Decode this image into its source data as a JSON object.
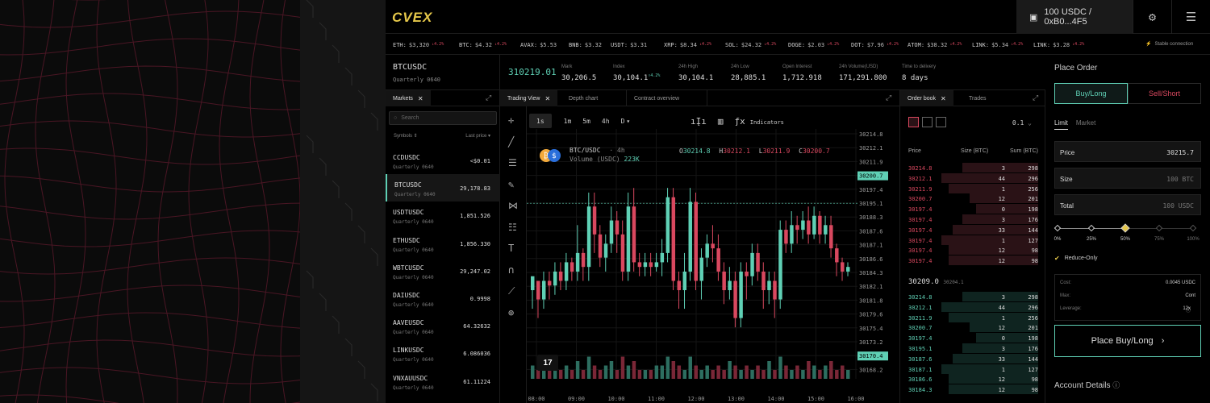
{
  "app": {
    "logo": "CVEX",
    "wallet": "100 USDC / 0xB0...4F5"
  },
  "ticker": [
    {
      "name": "ETH:",
      "price": "$3,320",
      "change": "↓4.2%"
    },
    {
      "name": "BTC:",
      "price": "$4.32",
      "change": "↓4.2%"
    },
    {
      "name": "AVAX:",
      "price": "$5.53",
      "change": ""
    },
    {
      "name": "BNB:",
      "price": "$3.32",
      "change": ""
    },
    {
      "name": "USDT:",
      "price": "$3.31",
      "change": ""
    },
    {
      "name": "XRP:",
      "price": "$8.34",
      "change": "↓4.2%"
    },
    {
      "name": "SOL:",
      "price": "$24.32",
      "change": "↓4.2%"
    },
    {
      "name": "DOGE:",
      "price": "$2.03",
      "change": "↓4.2%"
    },
    {
      "name": "DOT:",
      "price": "$7.96",
      "change": "↓4.2%"
    },
    {
      "name": "ATOM:",
      "price": "$38.32",
      "change": "↓4.2%"
    },
    {
      "name": "LINK:",
      "price": "$5.34",
      "change": "↓4.2%"
    },
    {
      "name": "LINK:",
      "price": "$3.28",
      "change": "↓4.2%"
    }
  ],
  "connection": "Stable connection",
  "symbol": {
    "name": "BTCUSDC",
    "sub": "Quarterly 0640"
  },
  "last_price": "310219.01",
  "stats": [
    {
      "label": "Mark",
      "value": "30,206.5",
      "sup": ""
    },
    {
      "label": "Index",
      "value": "30,104.1",
      "sup": "↑4.2%"
    },
    {
      "label": "24h High",
      "value": "30,104.1",
      "sup": ""
    },
    {
      "label": "24h Low",
      "value": "28,885.1",
      "sup": ""
    },
    {
      "label": "Open Interest",
      "value": "1,712.918",
      "sup": ""
    },
    {
      "label": "24h Volume(USD)",
      "value": "171,291.800",
      "sup": ""
    },
    {
      "label": "Time to delivery",
      "value": "8 days",
      "sup": ""
    }
  ],
  "markets": {
    "tab": "Markets",
    "search_placeholder": "Search",
    "col_symbols": "Symbols",
    "col_last": "Last price",
    "rows": [
      {
        "name": "CCDUSDC",
        "sub": "Quarterly 0640",
        "price": "<$0.01"
      },
      {
        "name": "BTCUSDC",
        "sub": "Quarterly 0640",
        "price": "29,178.83"
      },
      {
        "name": "USDTUSDC",
        "sub": "Quarterly 0640",
        "price": "1,851.526"
      },
      {
        "name": "ETHUSDC",
        "sub": "Quarterly 0640",
        "price": "1,856.330"
      },
      {
        "name": "WBTCUSDC",
        "sub": "Quarterly 0640",
        "price": "29,247.02"
      },
      {
        "name": "DAIUSDC",
        "sub": "Quarterly 0640",
        "price": "0.9998"
      },
      {
        "name": "AAVEUSDC",
        "sub": "Quarterly 0640",
        "price": "64.32632"
      },
      {
        "name": "LINKUSDC",
        "sub": "Quarterly 0640",
        "price": "6.086036"
      },
      {
        "name": "VNXAUUSDC",
        "sub": "Quarterly 0640",
        "price": "61.11224"
      }
    ]
  },
  "chart_tabs": [
    "Trading View",
    "Depth chart",
    "Contract overview"
  ],
  "timeframes": [
    "1s",
    "1m",
    "5m",
    "4h",
    "D"
  ],
  "indicators_label": "Indicators",
  "chart_legend": {
    "pair": "BTC/USDC",
    "interval": "4h",
    "volume_label": "Volume (USDC)",
    "volume": "223K",
    "o": "30214.8",
    "h": "30212.1",
    "l": "30211.9",
    "c": "30200.7"
  },
  "chart_data": {
    "type": "candlestick",
    "y_ticks": [
      "30214.8",
      "30212.1",
      "30211.9",
      "30200.7",
      "30197.4",
      "30195.1",
      "30188.3",
      "30187.6",
      "30187.1",
      "30186.6",
      "30184.3",
      "30182.1",
      "30181.8",
      "30179.6",
      "30175.4",
      "30173.2",
      "30170.4",
      "30168.2"
    ],
    "x_ticks": [
      "08:00",
      "09:00",
      "10:00",
      "11:00",
      "12:00",
      "13:00",
      "14:00",
      "15:00",
      "16:00"
    ],
    "price_marker": "30200.7",
    "low_marker": "30170.4",
    "ohlc": [
      [
        30182,
        30185,
        30178,
        30184
      ],
      [
        30184,
        30180,
        30176,
        30182
      ],
      [
        30180,
        30184,
        30178,
        30186
      ],
      [
        30184,
        30183,
        30180,
        30186
      ],
      [
        30183,
        30186,
        30181,
        30188
      ],
      [
        30186,
        30184,
        30182,
        30188
      ],
      [
        30184,
        30188,
        30182,
        30190
      ],
      [
        30188,
        30186,
        30184,
        30189
      ],
      [
        30186,
        30190,
        30184,
        30196
      ],
      [
        30190,
        30187,
        30184,
        30191
      ],
      [
        30187,
        30200,
        30184,
        30203
      ],
      [
        30200,
        30194,
        30190,
        30203
      ],
      [
        30194,
        30189,
        30187,
        30196
      ],
      [
        30189,
        30192,
        30186,
        30194
      ],
      [
        30192,
        30197,
        30190,
        30200
      ],
      [
        30197,
        30194,
        30190,
        30199
      ],
      [
        30194,
        30186,
        30184,
        30197
      ],
      [
        30186,
        30200,
        30184,
        30203
      ],
      [
        30200,
        30188,
        30186,
        30204
      ],
      [
        30188,
        30187,
        30185,
        30190
      ],
      [
        30187,
        30188,
        30185,
        30190
      ],
      [
        30188,
        30187,
        30185,
        30190
      ],
      [
        30187,
        30188,
        30186,
        30190
      ],
      [
        30188,
        30190,
        30185,
        30193
      ],
      [
        30190,
        30202,
        30188,
        30204
      ],
      [
        30202,
        30184,
        30182,
        30204
      ],
      [
        30184,
        30182,
        30178,
        30186
      ],
      [
        30182,
        30186,
        30178,
        30190
      ],
      [
        30186,
        30201,
        30184,
        30204
      ],
      [
        30201,
        30184,
        30182,
        30203
      ],
      [
        30184,
        30189,
        30180,
        30191
      ],
      [
        30189,
        30192,
        30187,
        30194
      ],
      [
        30192,
        30191,
        30188,
        30196
      ],
      [
        30191,
        30186,
        30184,
        30194
      ],
      [
        30186,
        30182,
        30179,
        30188
      ],
      [
        30182,
        30184,
        30180,
        30187
      ],
      [
        30184,
        30176,
        30174,
        30186
      ],
      [
        30176,
        30186,
        30174,
        30188
      ],
      [
        30186,
        30185,
        30180,
        30188
      ],
      [
        30185,
        30190,
        30183,
        30192
      ],
      [
        30190,
        30186,
        30184,
        30192
      ],
      [
        30186,
        30182,
        30178,
        30188
      ],
      [
        30182,
        30184,
        30179,
        30186
      ],
      [
        30184,
        30180,
        30176,
        30186
      ],
      [
        30180,
        30195,
        30178,
        30197
      ],
      [
        30195,
        30192,
        30190,
        30197
      ],
      [
        30192,
        30196,
        30190,
        30199
      ],
      [
        30196,
        30195,
        30192,
        30198
      ],
      [
        30195,
        30197,
        30193,
        30199
      ],
      [
        30197,
        30194,
        30192,
        30200
      ],
      [
        30194,
        30198,
        30193,
        30200
      ],
      [
        30198,
        30194,
        30192,
        30199
      ],
      [
        30194,
        30196,
        30192,
        30198
      ],
      [
        30196,
        30191,
        30189,
        30198
      ],
      [
        30191,
        30188,
        30185,
        30192
      ],
      [
        30188,
        30186,
        30184,
        30189
      ],
      [
        30186,
        30187,
        30185,
        30188
      ]
    ],
    "volume": [
      3,
      2,
      4,
      2,
      3,
      2,
      3,
      2,
      4,
      2,
      5,
      3,
      2,
      3,
      4,
      2,
      5,
      3,
      4,
      2,
      2,
      2,
      3,
      3,
      5,
      4,
      3,
      2,
      5,
      3,
      2,
      3,
      2,
      3,
      2,
      4,
      3,
      2,
      3,
      2,
      3,
      2,
      4,
      2,
      5,
      3,
      2,
      3,
      2,
      4,
      3,
      2,
      3,
      4,
      2,
      3,
      2
    ]
  },
  "orderbook": {
    "tabs": [
      "Order book",
      "Trades"
    ],
    "step": "0.1",
    "headers": [
      "Price",
      "Size (BTC)",
      "Sum (BTC)"
    ],
    "asks": [
      {
        "p": "30214.8",
        "s": "3",
        "t": "298",
        "d": 0.55
      },
      {
        "p": "30212.1",
        "s": "44",
        "t": "296",
        "d": 0.7
      },
      {
        "p": "30211.9",
        "s": "1",
        "t": "256",
        "d": 0.65
      },
      {
        "p": "30200.7",
        "s": "12",
        "t": "201",
        "d": 0.5
      },
      {
        "p": "30197.4",
        "s": "0",
        "t": "198",
        "d": 0.45
      },
      {
        "p": "30197.4",
        "s": "3",
        "t": "176",
        "d": 0.55
      },
      {
        "p": "30197.4",
        "s": "33",
        "t": "144",
        "d": 0.62
      },
      {
        "p": "30197.4",
        "s": "1",
        "t": "127",
        "d": 0.7
      },
      {
        "p": "30197.4",
        "s": "12",
        "t": "98",
        "d": 0.65
      },
      {
        "p": "30197.4",
        "s": "12",
        "t": "98",
        "d": 0.65
      }
    ],
    "mid": "30209.0",
    "mid_sub": "30204.1",
    "bids": [
      {
        "p": "30214.8",
        "s": "3",
        "t": "298",
        "d": 0.55
      },
      {
        "p": "30212.1",
        "s": "44",
        "t": "296",
        "d": 0.7
      },
      {
        "p": "30211.9",
        "s": "1",
        "t": "256",
        "d": 0.65
      },
      {
        "p": "30200.7",
        "s": "12",
        "t": "201",
        "d": 0.5
      },
      {
        "p": "30197.4",
        "s": "0",
        "t": "198",
        "d": 0.45
      },
      {
        "p": "30195.1",
        "s": "3",
        "t": "176",
        "d": 0.55
      },
      {
        "p": "30187.6",
        "s": "33",
        "t": "144",
        "d": 0.62
      },
      {
        "p": "30187.1",
        "s": "1",
        "t": "127",
        "d": 0.7
      },
      {
        "p": "30186.6",
        "s": "12",
        "t": "98",
        "d": 0.65
      },
      {
        "p": "30184.3",
        "s": "12",
        "t": "98",
        "d": 0.65
      }
    ]
  },
  "place_order": {
    "title": "Place Order",
    "buy": "Buy/Long",
    "sell": "Sell/Short",
    "types": [
      "Limit",
      "Market"
    ],
    "price_label": "Price",
    "price": "30215.7",
    "size_label": "Size",
    "size": "100 BTC",
    "total_label": "Total",
    "total": "100 USDC",
    "slider_marks": [
      "0%",
      "25%",
      "50%",
      "75%",
      "100%"
    ],
    "slider_value": 0.5,
    "reduce_only": "Reduce-Only",
    "cost_label": "Cost:",
    "cost": "0.0045 USDC",
    "max_label": "Max:",
    "max": "Cont",
    "lev_label": "Leverage:",
    "lev": "12x",
    "submit": "Place Buy/Long",
    "account": "Account Details"
  },
  "colors": {
    "up": "#5fd0b5",
    "down": "#d9485f",
    "accent": "#e6c84a"
  }
}
